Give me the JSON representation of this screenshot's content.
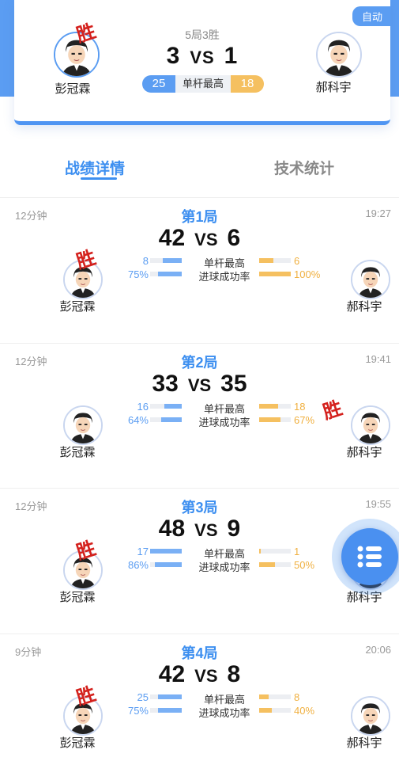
{
  "header": {
    "auto_badge": "自动",
    "rule": "5局3胜",
    "score_left": "3",
    "vs": "VS",
    "score_right": "1",
    "left_player": "彭冠霖",
    "right_player": "郝科宇",
    "win_mark": "胜",
    "high_break_label": "单杆最高",
    "high_break_left": "25",
    "high_break_right": "18"
  },
  "tabs": [
    {
      "label": "战绩详情",
      "active": true
    },
    {
      "label": "技术统计",
      "active": false
    }
  ],
  "stat_labels": {
    "high": "单杆最高",
    "rate": "进球成功率"
  },
  "games": [
    {
      "title": "第1局",
      "duration": "12分钟",
      "time": "19:27",
      "score_left": "42",
      "score_right": "6",
      "winner": "left",
      "left_player": "彭冠霖",
      "right_player": "郝科宇",
      "high_left": "8",
      "high_right": "6",
      "high_left_frac": 0.6,
      "high_right_frac": 0.45,
      "rate_left": "75%",
      "rate_right": "100%",
      "rate_left_frac": 0.75,
      "rate_right_frac": 1.0
    },
    {
      "title": "第2局",
      "duration": "12分钟",
      "time": "19:41",
      "score_left": "33",
      "score_right": "35",
      "winner": "right",
      "left_player": "彭冠霖",
      "right_player": "郝科宇",
      "high_left": "16",
      "high_right": "18",
      "high_left_frac": 0.55,
      "high_right_frac": 0.6,
      "rate_left": "64%",
      "rate_right": "67%",
      "rate_left_frac": 0.64,
      "rate_right_frac": 0.67
    },
    {
      "title": "第3局",
      "duration": "12分钟",
      "time": "19:55",
      "score_left": "48",
      "score_right": "9",
      "winner": "left",
      "left_player": "彭冠霖",
      "right_player": "郝科宇",
      "high_left": "17",
      "high_right": "1",
      "high_left_frac": 1.0,
      "high_right_frac": 0.06,
      "rate_left": "86%",
      "rate_right": "50%",
      "rate_left_frac": 0.86,
      "rate_right_frac": 0.5
    },
    {
      "title": "第4局",
      "duration": "9分钟",
      "time": "20:06",
      "score_left": "42",
      "score_right": "8",
      "winner": "left",
      "left_player": "彭冠霖",
      "right_player": "郝科宇",
      "high_left": "25",
      "high_right": "8",
      "high_left_frac": 0.75,
      "high_right_frac": 0.3,
      "rate_left": "75%",
      "rate_right": "40%",
      "rate_left_frac": 0.75,
      "rate_right_frac": 0.4
    }
  ],
  "fab_icon": "list-menu-icon",
  "colors": {
    "accent": "#3d8ff0",
    "left_bar": "#7ab0f5",
    "right_bar": "#f5c060",
    "win": "#d4211d"
  }
}
